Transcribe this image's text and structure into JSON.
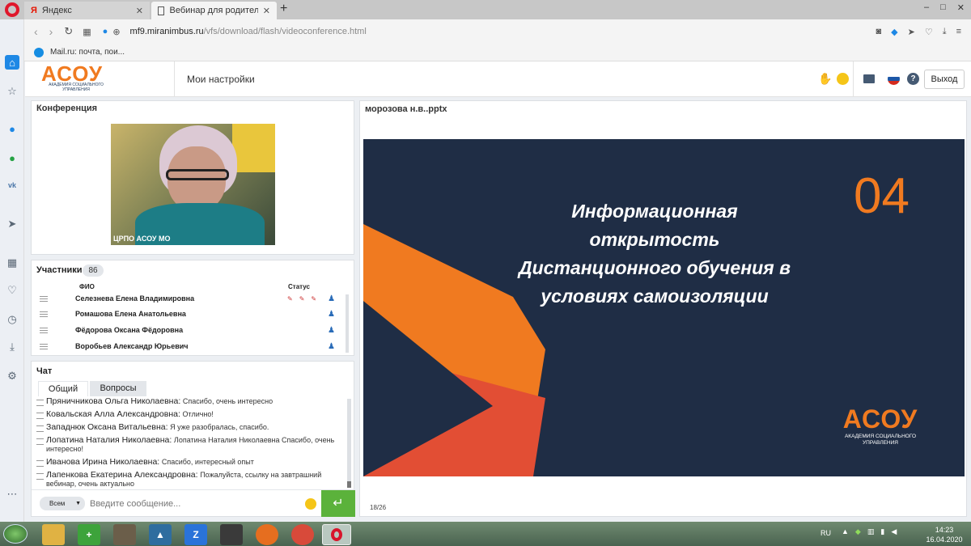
{
  "browser": {
    "tabs": [
      {
        "label": "Яндекс",
        "active": false
      },
      {
        "label": "Вебинар для родителей-с",
        "active": true
      }
    ],
    "new_tab": "+",
    "url": {
      "host": "mf9.miranimbus.ru",
      "path": "/vfs/download/flash/videoconference.html"
    },
    "bookmark": "Mail.ru: почта, пои...",
    "window_controls": [
      "–",
      "□",
      "✕"
    ]
  },
  "app": {
    "logo_main": "АСОУ",
    "logo_sub": "АКАДЕМИЯ СОЦИАЛЬНОГО УПРАВЛЕНИЯ",
    "settings_label": "Мои настройки",
    "exit_label": "Выход"
  },
  "conference": {
    "title": "Конференция",
    "video_caption": "ЦРПО АСОУ МО"
  },
  "participants": {
    "title": "Участники",
    "count": "86",
    "col_name": "ФИО",
    "col_status": "Статус",
    "rows": [
      {
        "name": "Селезнева Елена  Владимировна"
      },
      {
        "name": "Ромашова Елена Анатольевна"
      },
      {
        "name": "Фёдорова Оксана Фёдоровна"
      },
      {
        "name": "Воробьев Александр Юрьевич"
      }
    ]
  },
  "chat": {
    "title": "Чат",
    "tabs": [
      "Общий",
      "Вопросы"
    ],
    "messages": [
      {
        "who": "Пряничникова  Ольга  Николаевна:",
        "msg": "Спасибо, очень интересно"
      },
      {
        "who": "Ковальская Алла Александровна:",
        "msg": "Отлично!"
      },
      {
        "who": "Западнюк Оксана Витальевна:",
        "msg": "Я уже разобралась, спасибо."
      },
      {
        "who": "Лопатина  Наталия  Николаевна:",
        "msg": "Лопатина Наталия Николаевна Спасибо, очень интересно!"
      },
      {
        "who": "Иванова Ирина Николаевна:",
        "msg": "Спасибо, интересный опыт"
      },
      {
        "who": "Лапенкова Екатерина Александровна:",
        "msg": "Пожалуйста, ссылку на завтрашний вебинар, очень актуально"
      }
    ],
    "recipient": "Всем",
    "input_placeholder": "Введите сообщение..."
  },
  "presentation": {
    "file": "морозова н.в..pptx",
    "slide_number": "04",
    "slide_lines": [
      "Информационная",
      "открытость",
      "Дистанционного обучения в",
      "условиях самоизоляции"
    ],
    "slide_logo_main": "АСОУ",
    "slide_logo_sub": "АКАДЕМИЯ СОЦИАЛЬНОГО УПРАВЛЕНИЯ",
    "page": "18/26"
  },
  "taskbar": {
    "lang": "RU",
    "time": "14:23",
    "date": "16.04.2020"
  },
  "colors": {
    "accent_green": "#5bb23b",
    "slide_bg": "#1f2d45",
    "slide_orange": "#f07a20"
  }
}
